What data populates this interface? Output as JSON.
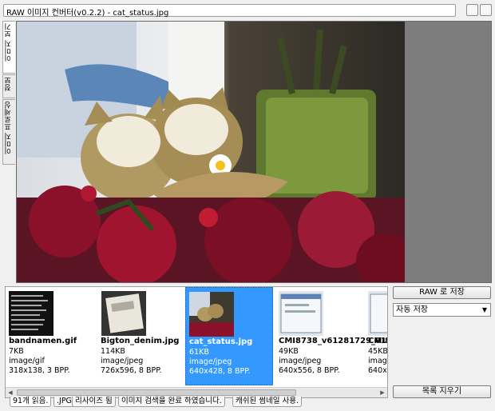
{
  "window": {
    "title": "RAW 이미지 컨버터(v0.2.2) - cat_status.jpg"
  },
  "side_tabs": [
    "이미지 보기",
    "정보",
    "이미지 프로세싱"
  ],
  "thumbnails": [
    {
      "name": "bandnamen.gif",
      "size": "7KB",
      "type": "image/gif",
      "dims": "318x138, 3 BPP.",
      "selected": false
    },
    {
      "name": "Bigton_denim.jpg",
      "size": "114KB",
      "type": "image/jpeg",
      "dims": "726x596, 8 BPP.",
      "selected": false
    },
    {
      "name": "cat_status.jpg",
      "size": "61KB",
      "type": "image/jpeg",
      "dims": "640x428, 8 BPP.",
      "selected": true
    },
    {
      "name": "CMI8738_v61281729_01",
      "size": "49KB",
      "type": "image/jpeg",
      "dims": "640x556, 8 BPP.",
      "selected": false
    },
    {
      "name": "CMI87",
      "size": "45KB",
      "type": "image/",
      "dims": "640x55",
      "selected": false
    }
  ],
  "buttons": {
    "save_raw": "RAW 로 저장",
    "auto_save": "자동 저장",
    "clear_list": "목록 지우기"
  },
  "status_tabs": [
    "91개 읽음.",
    ".JPG",
    "리사이즈 됨",
    "이미지 검색을 완료 하였습니다.",
    "캐쉬된 썸네일 사용."
  ],
  "colors": {
    "selection": "#3399ff",
    "viewer_bg": "#7d7d7d"
  }
}
